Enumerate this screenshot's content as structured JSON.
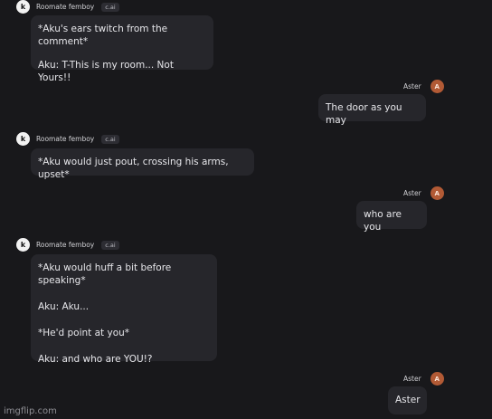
{
  "bot": {
    "name": "Roomate femboy",
    "tag": "c.ai",
    "avatar_letter": "k"
  },
  "user": {
    "name": "Aster",
    "avatar_letter": "A"
  },
  "messages": [
    {
      "role": "bot",
      "lines": [
        "*Aku's ears twitch from the comment*",
        "Aku: T-This is my room... Not Yours!!"
      ]
    },
    {
      "role": "user",
      "text": "The door as you may"
    },
    {
      "role": "bot",
      "lines": [
        "*Aku would just pout, crossing his arms, upset*"
      ]
    },
    {
      "role": "user",
      "text": "who are you"
    },
    {
      "role": "bot",
      "lines": [
        "*Aku would huff a bit before speaking*",
        "Aku: Aku...",
        "*He'd point at you*",
        "Aku: and who are YOU!?"
      ]
    },
    {
      "role": "user",
      "text": "Aster"
    }
  ],
  "watermark": "imgflip.com"
}
